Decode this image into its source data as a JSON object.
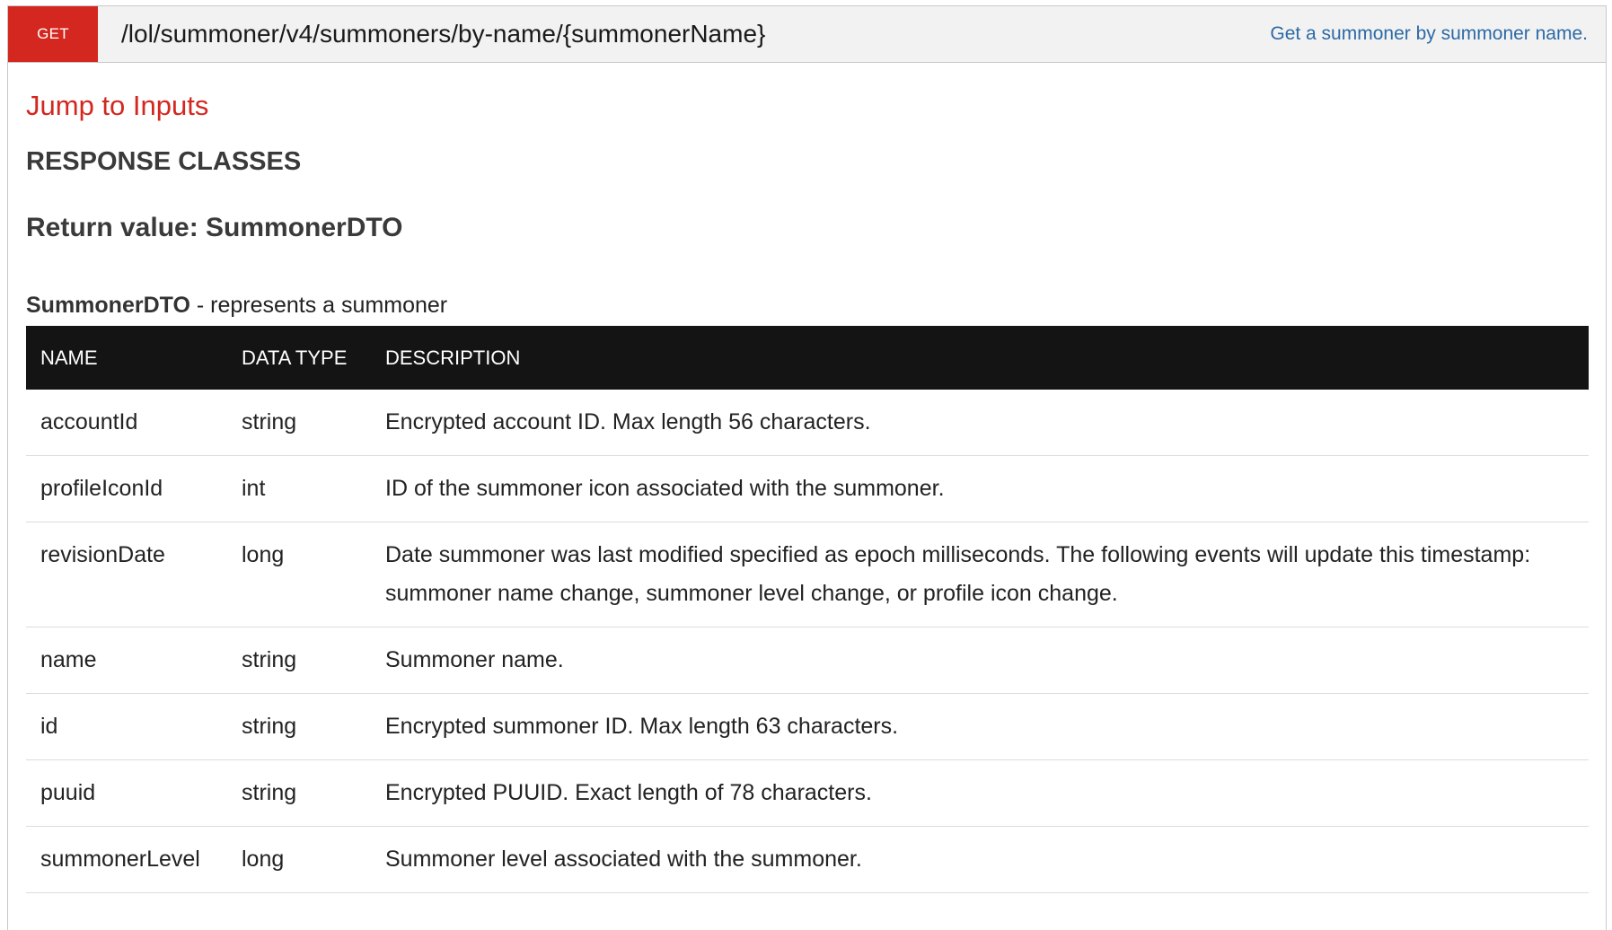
{
  "endpoint": {
    "method": "GET",
    "path": "/lol/summoner/v4/summoners/by-name/{summonerName}",
    "summary": "Get a summoner by summoner name."
  },
  "content": {
    "jump_link": "Jump to Inputs",
    "response_heading": "RESPONSE CLASSES",
    "return_value": "Return value: SummonerDTO",
    "dto_name": "SummonerDTO",
    "dto_description": " - represents a summoner"
  },
  "table": {
    "headers": [
      "NAME",
      "DATA TYPE",
      "DESCRIPTION"
    ],
    "rows": [
      {
        "name": "accountId",
        "type": "string",
        "description": "Encrypted account ID. Max length 56 characters."
      },
      {
        "name": "profileIconId",
        "type": "int",
        "description": "ID of the summoner icon associated with the summoner."
      },
      {
        "name": "revisionDate",
        "type": "long",
        "description": "Date summoner was last modified specified as epoch milliseconds. The following events will update this timestamp: summoner name change, summoner level change, or profile icon change."
      },
      {
        "name": "name",
        "type": "string",
        "description": "Summoner name."
      },
      {
        "name": "id",
        "type": "string",
        "description": "Encrypted summoner ID. Max length 63 characters."
      },
      {
        "name": "puuid",
        "type": "string",
        "description": "Encrypted PUUID. Exact length of 78 characters."
      },
      {
        "name": "summonerLevel",
        "type": "long",
        "description": "Summoner level associated with the summoner."
      }
    ]
  },
  "colors": {
    "method_badge": "#d3271f",
    "jump_link": "#d3271f",
    "summary_link": "#2c6aa6",
    "table_header_bg": "#141414"
  }
}
